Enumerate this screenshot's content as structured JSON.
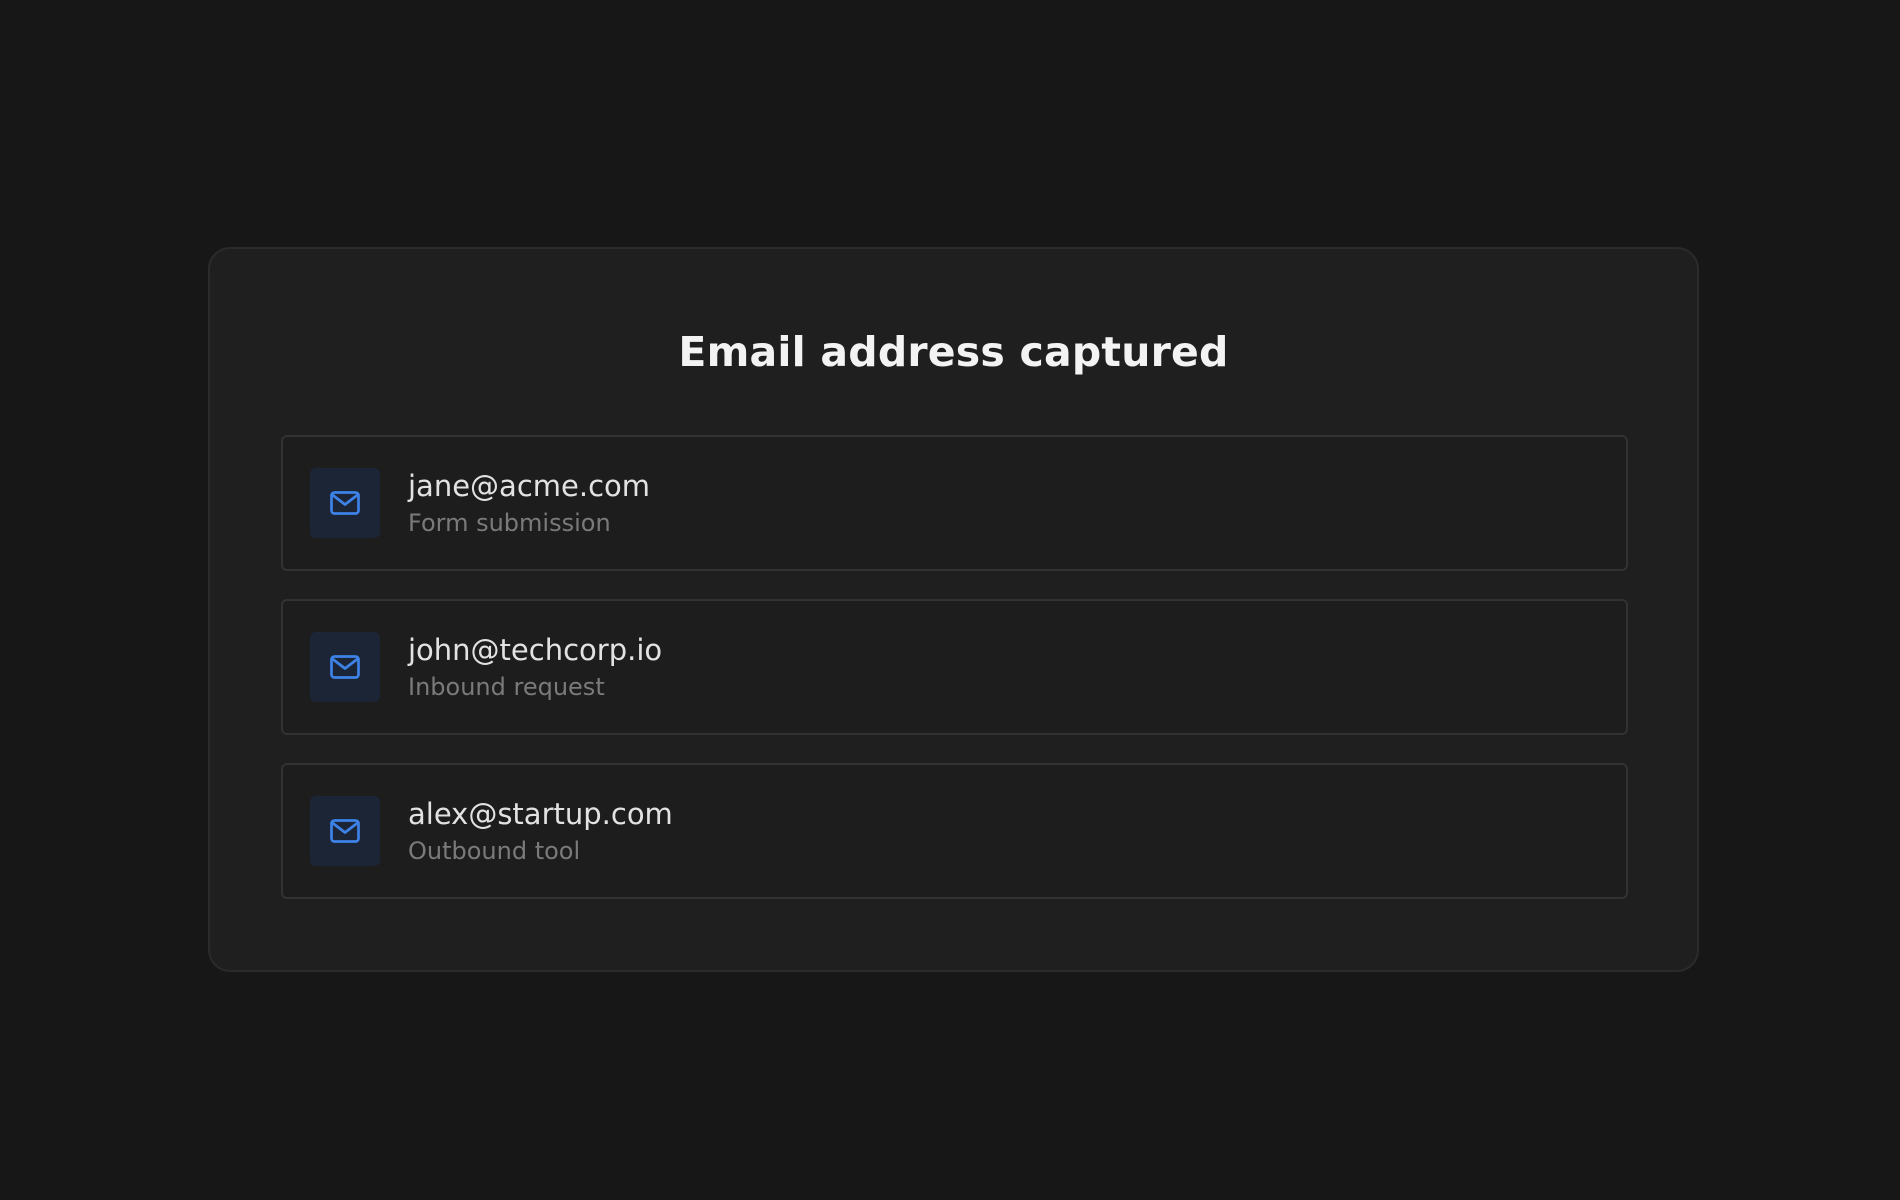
{
  "title": "Email address captured",
  "accent_color": "#3d82e6",
  "emails": [
    {
      "icon": "mail-icon",
      "address": "jane@acme.com",
      "source": "Form submission"
    },
    {
      "icon": "mail-icon",
      "address": "john@techcorp.io",
      "source": "Inbound request"
    },
    {
      "icon": "mail-icon",
      "address": "alex@startup.com",
      "source": "Outbound tool"
    }
  ]
}
